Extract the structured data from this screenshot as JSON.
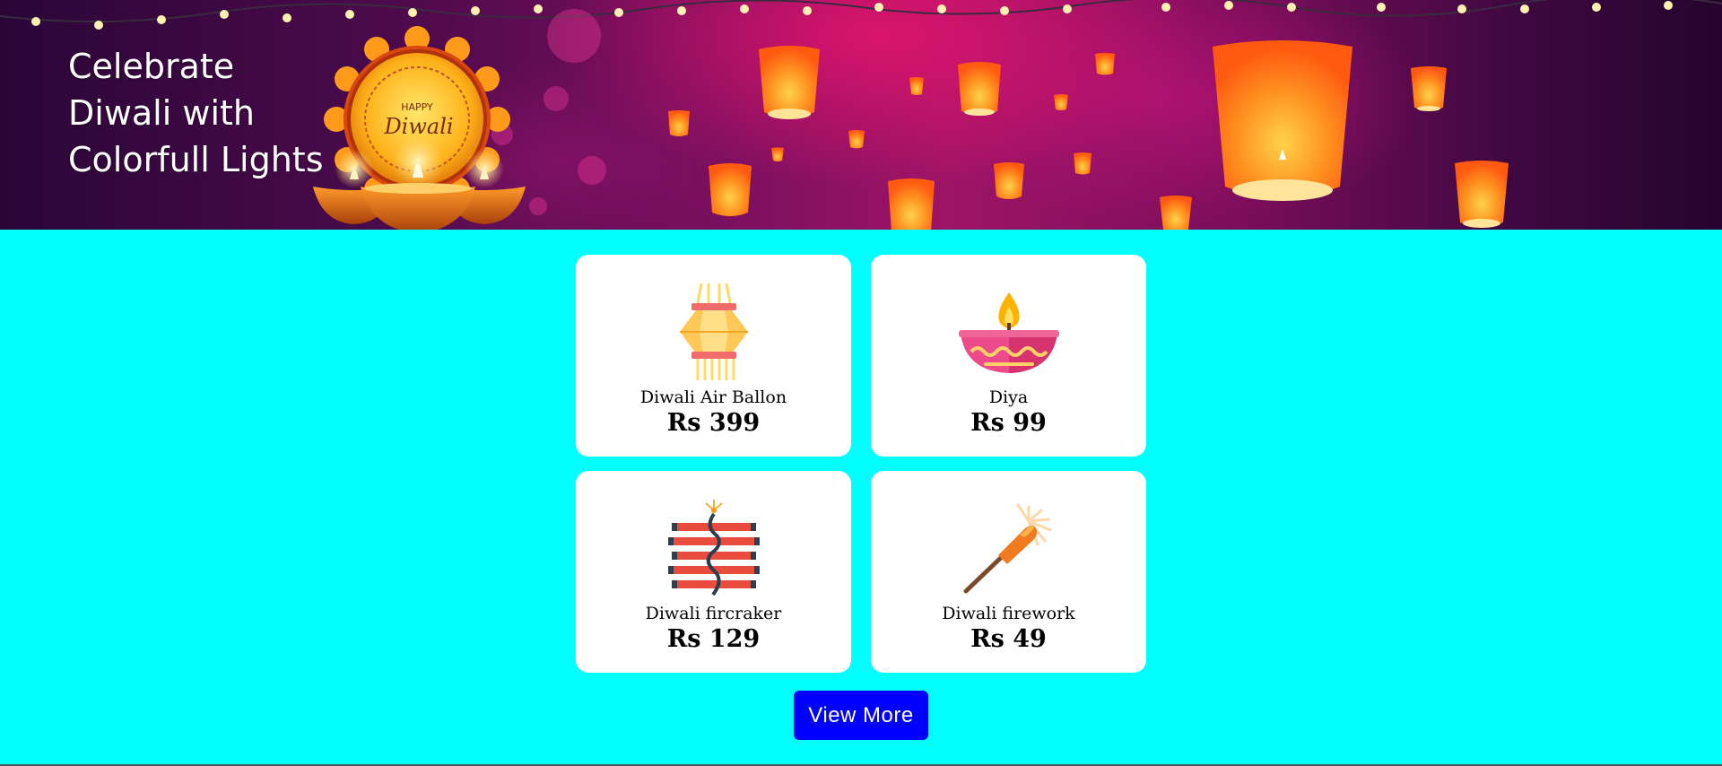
{
  "hero": {
    "title": "Celebrate\nDiwali with\nColorfull Lights",
    "emblem_text": [
      "HAPPY",
      "Diwali"
    ],
    "background_colors": [
      "#2a0637",
      "#9e1466",
      "#25042e"
    ]
  },
  "products": [
    {
      "name": "Diwali Air Ballon",
      "price": "Rs 399",
      "icon": "hanging-lantern-icon"
    },
    {
      "name": "Diya",
      "price": "Rs 99",
      "icon": "diya-lamp-icon"
    },
    {
      "name": "Diwali fircraker",
      "price": "Rs 129",
      "icon": "firecracker-bundle-icon"
    },
    {
      "name": "Diwali firework",
      "price": "Rs 49",
      "icon": "sparkler-icon"
    }
  ],
  "view_more_label": "View More",
  "colors": {
    "page_background": "#00ffff",
    "card_background": "#ffffff",
    "button_background": "#0000ff",
    "button_text": "#ffffff"
  }
}
